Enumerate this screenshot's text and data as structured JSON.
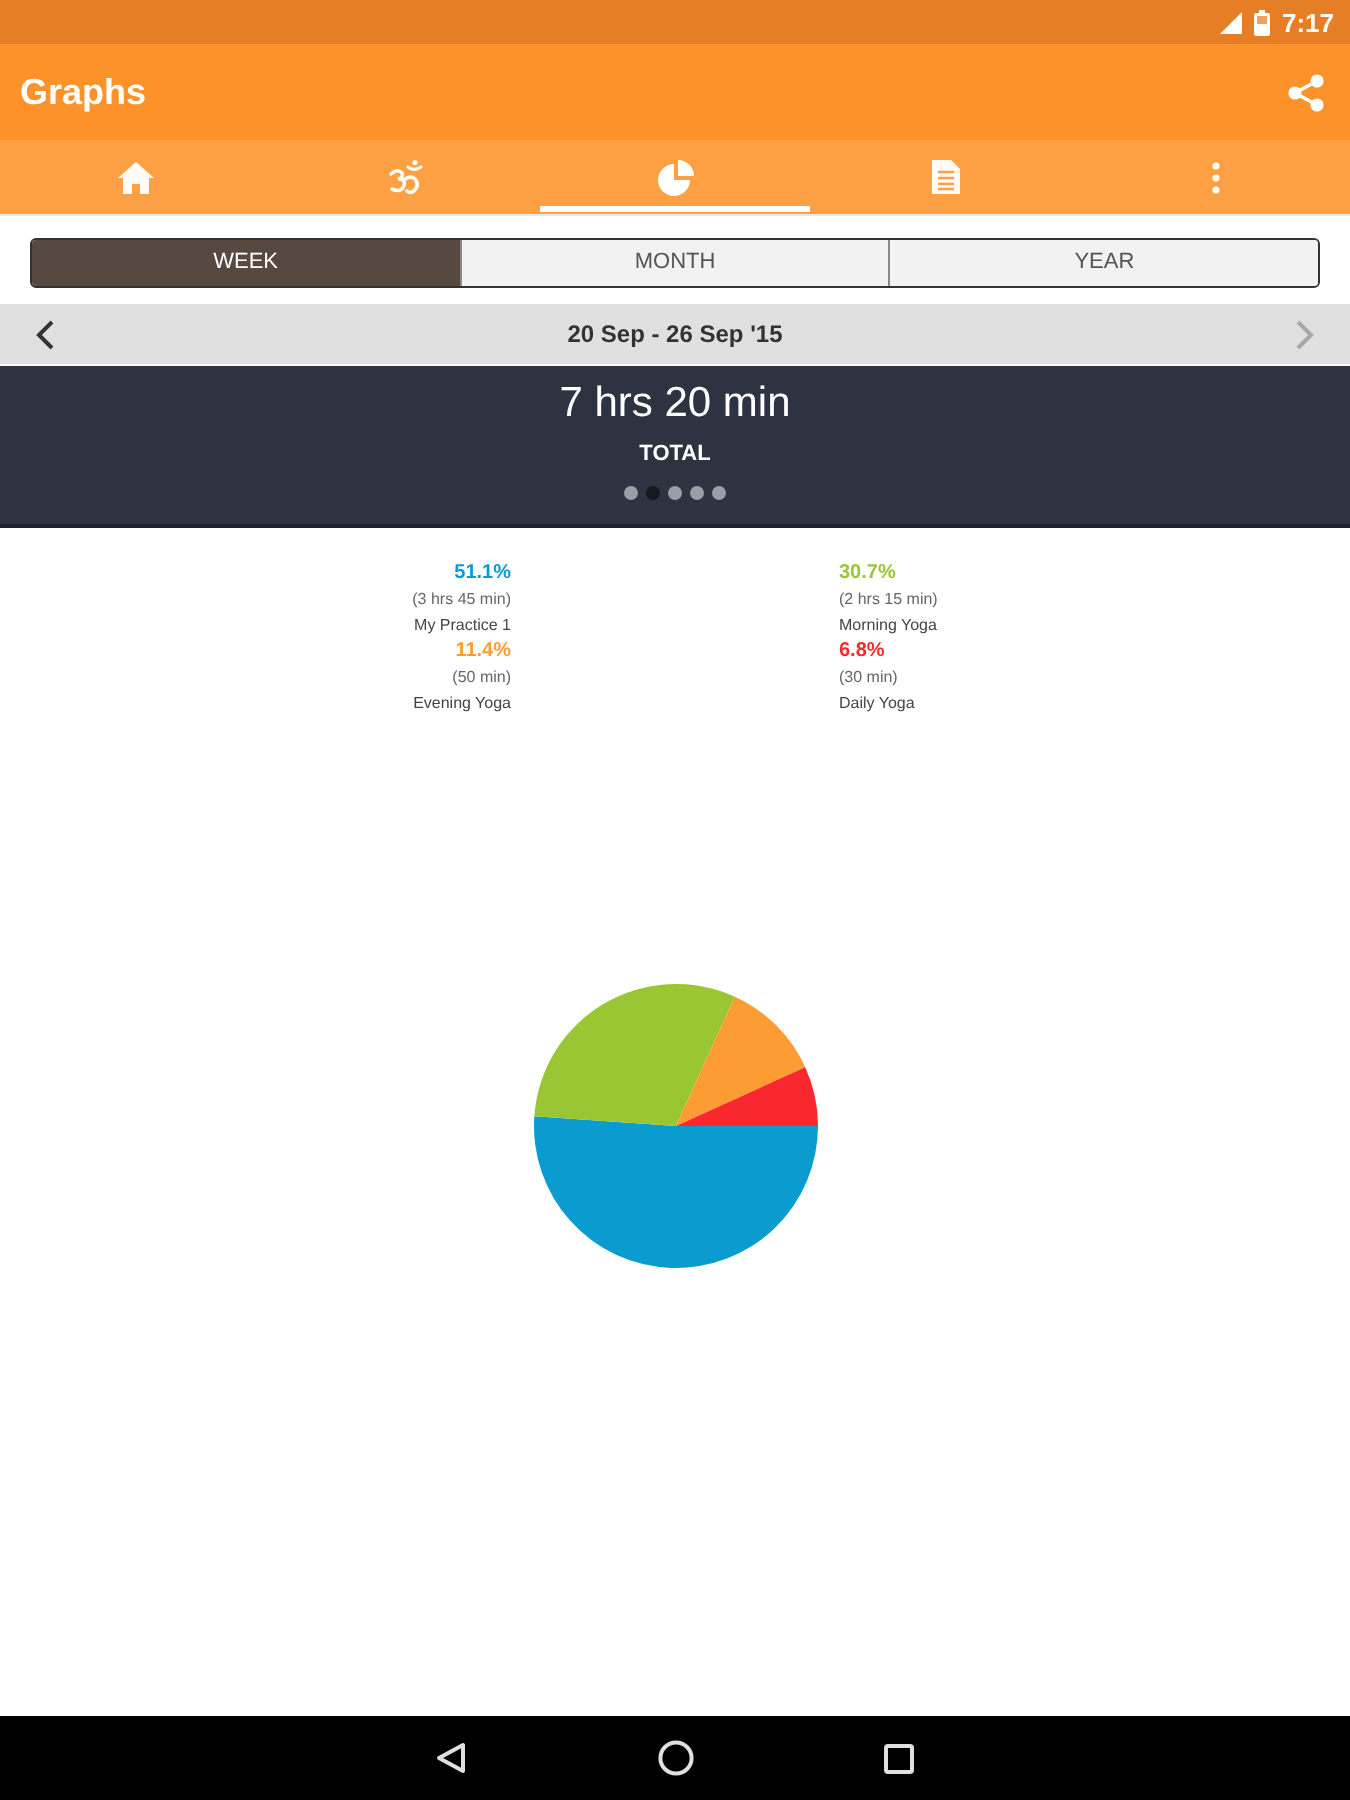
{
  "status_bar": {
    "time": "7:17"
  },
  "app_bar": {
    "title": "Graphs"
  },
  "tabs": [
    {
      "selected": false
    },
    {
      "selected": false
    },
    {
      "selected": true
    },
    {
      "selected": false
    },
    {
      "selected": false
    }
  ],
  "range_selector": [
    {
      "label": "WEEK",
      "selected": true
    },
    {
      "label": "MONTH",
      "selected": false
    },
    {
      "label": "YEAR",
      "selected": false
    }
  ],
  "date_nav": {
    "label": "20 Sep - 26 Sep '15",
    "previous": {
      "disabled": false
    },
    "next": {
      "disabled": true
    }
  },
  "summary": {
    "total": "7 hrs 20 min",
    "caption": "TOTAL",
    "pages": [
      {
        "selected": false
      },
      {
        "selected": true
      },
      {
        "selected": false
      },
      {
        "selected": false
      },
      {
        "selected": false
      }
    ]
  },
  "graph": {
    "legend": [
      {
        "percent": "51.1%",
        "duration": "(3 hrs 45 min)",
        "color": "#0a9bcf"
      },
      {
        "percent": "30.7%",
        "duration": "(2 hrs 15 min)",
        "color": "#9ac634"
      },
      {
        "percent": "11.4%",
        "duration": "(50 min)",
        "color": "#fd9c32"
      },
      {
        "percent": "6.8%",
        "duration": "(30 min)",
        "color": "#f9282f"
      }
    ],
    "chart_data": {
      "type": "pie",
      "categories": [
        "My Practice 1",
        "Morning Yoga",
        "Evening Yoga",
        "Daily Yoga"
      ],
      "values": [
        51.1,
        30.7,
        11.4,
        6.8
      ]
    }
  }
}
